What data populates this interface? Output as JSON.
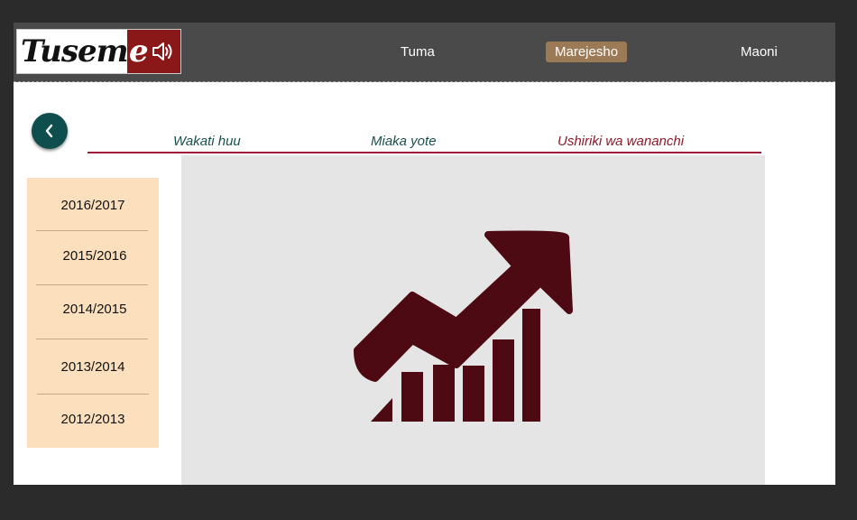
{
  "logo": {
    "text_main": "Tusem",
    "text_accent": "e",
    "icon": "speaker-icon"
  },
  "nav": {
    "items": [
      "Tuma",
      "Marejesho",
      "Maoni"
    ],
    "active": "Marejesho"
  },
  "back_button": {
    "icon": "chevron-left-icon"
  },
  "tabs": [
    "Wakati huu",
    "Miaka yote",
    "Ushiriki wa wananchi"
  ],
  "years": [
    "2016/2017",
    "2015/2016",
    "2014/2015",
    "2013/2014",
    "2012/2013"
  ],
  "content": {
    "icon": "growth-chart-icon"
  },
  "colors": {
    "topbar": "#4a4a4a",
    "active_nav": "#9b7a55",
    "tab_teal": "#1b4f4f",
    "tab_maroon": "#8b1a2b",
    "year_panel": "#fce0bd",
    "chart_icon": "#4d0a12",
    "back_button": "#0f4e4e"
  }
}
